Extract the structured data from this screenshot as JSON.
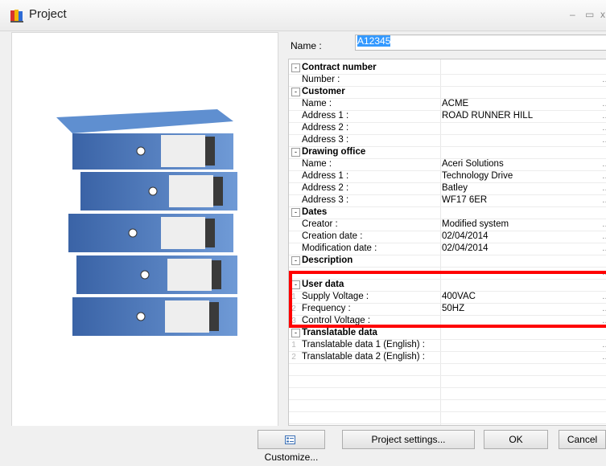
{
  "window": {
    "title": "Project",
    "min_glyph": "–",
    "max_glyph": "▭",
    "close_glyph": "x"
  },
  "name_field": {
    "label": "Name :",
    "value": "A12345"
  },
  "properties": [
    {
      "kind": "group",
      "label": "Contract number",
      "value": ""
    },
    {
      "kind": "item",
      "label": "Number :",
      "value": ""
    },
    {
      "kind": "group",
      "label": "Customer",
      "value": ""
    },
    {
      "kind": "item",
      "label": "Name :",
      "value": "ACME"
    },
    {
      "kind": "item",
      "label": "Address 1 :",
      "value": "ROAD RUNNER HILL"
    },
    {
      "kind": "item",
      "label": "Address 2 :",
      "value": ""
    },
    {
      "kind": "item",
      "label": "Address 3 :",
      "value": ""
    },
    {
      "kind": "group",
      "label": "Drawing office",
      "value": ""
    },
    {
      "kind": "item",
      "label": "Name :",
      "value": "Aceri Solutions"
    },
    {
      "kind": "item",
      "label": "Address 1 :",
      "value": "Technology Drive"
    },
    {
      "kind": "item",
      "label": "Address 2 :",
      "value": "Batley"
    },
    {
      "kind": "item",
      "label": "Address 3 :",
      "value": "WF17 6ER"
    },
    {
      "kind": "group",
      "label": "Dates",
      "value": ""
    },
    {
      "kind": "item",
      "label": "Creator :",
      "value": "Modified system"
    },
    {
      "kind": "item",
      "label": "Creation date :",
      "value": "02/04/2014"
    },
    {
      "kind": "item",
      "label": "Modification date :",
      "value": "02/04/2014"
    },
    {
      "kind": "group",
      "label": "Description",
      "value": ""
    },
    {
      "kind": "item",
      "label": "",
      "value": ""
    },
    {
      "kind": "group",
      "label": "User data",
      "value": ""
    },
    {
      "kind": "item",
      "num": "1",
      "label": "Supply Voltage :",
      "value": "400VAC"
    },
    {
      "kind": "item",
      "num": "2",
      "label": "Frequency :",
      "value": "50HZ"
    },
    {
      "kind": "item",
      "num": "3",
      "label": "Control Voltage :",
      "value": ""
    },
    {
      "kind": "group",
      "label": "Translatable data",
      "value": ""
    },
    {
      "kind": "item",
      "num": "1",
      "label": "Translatable data 1 (English) :",
      "value": ""
    },
    {
      "kind": "item",
      "num": "2",
      "label": "Translatable data 2 (English) :",
      "value": ""
    }
  ],
  "buttons": {
    "customize": "Customize...",
    "project_settings": "Project settings...",
    "ok": "OK",
    "cancel": "Cancel"
  },
  "colors": {
    "highlight": "#ff0000",
    "binder_blue": "#4a77b8",
    "selection": "#3399ff"
  }
}
